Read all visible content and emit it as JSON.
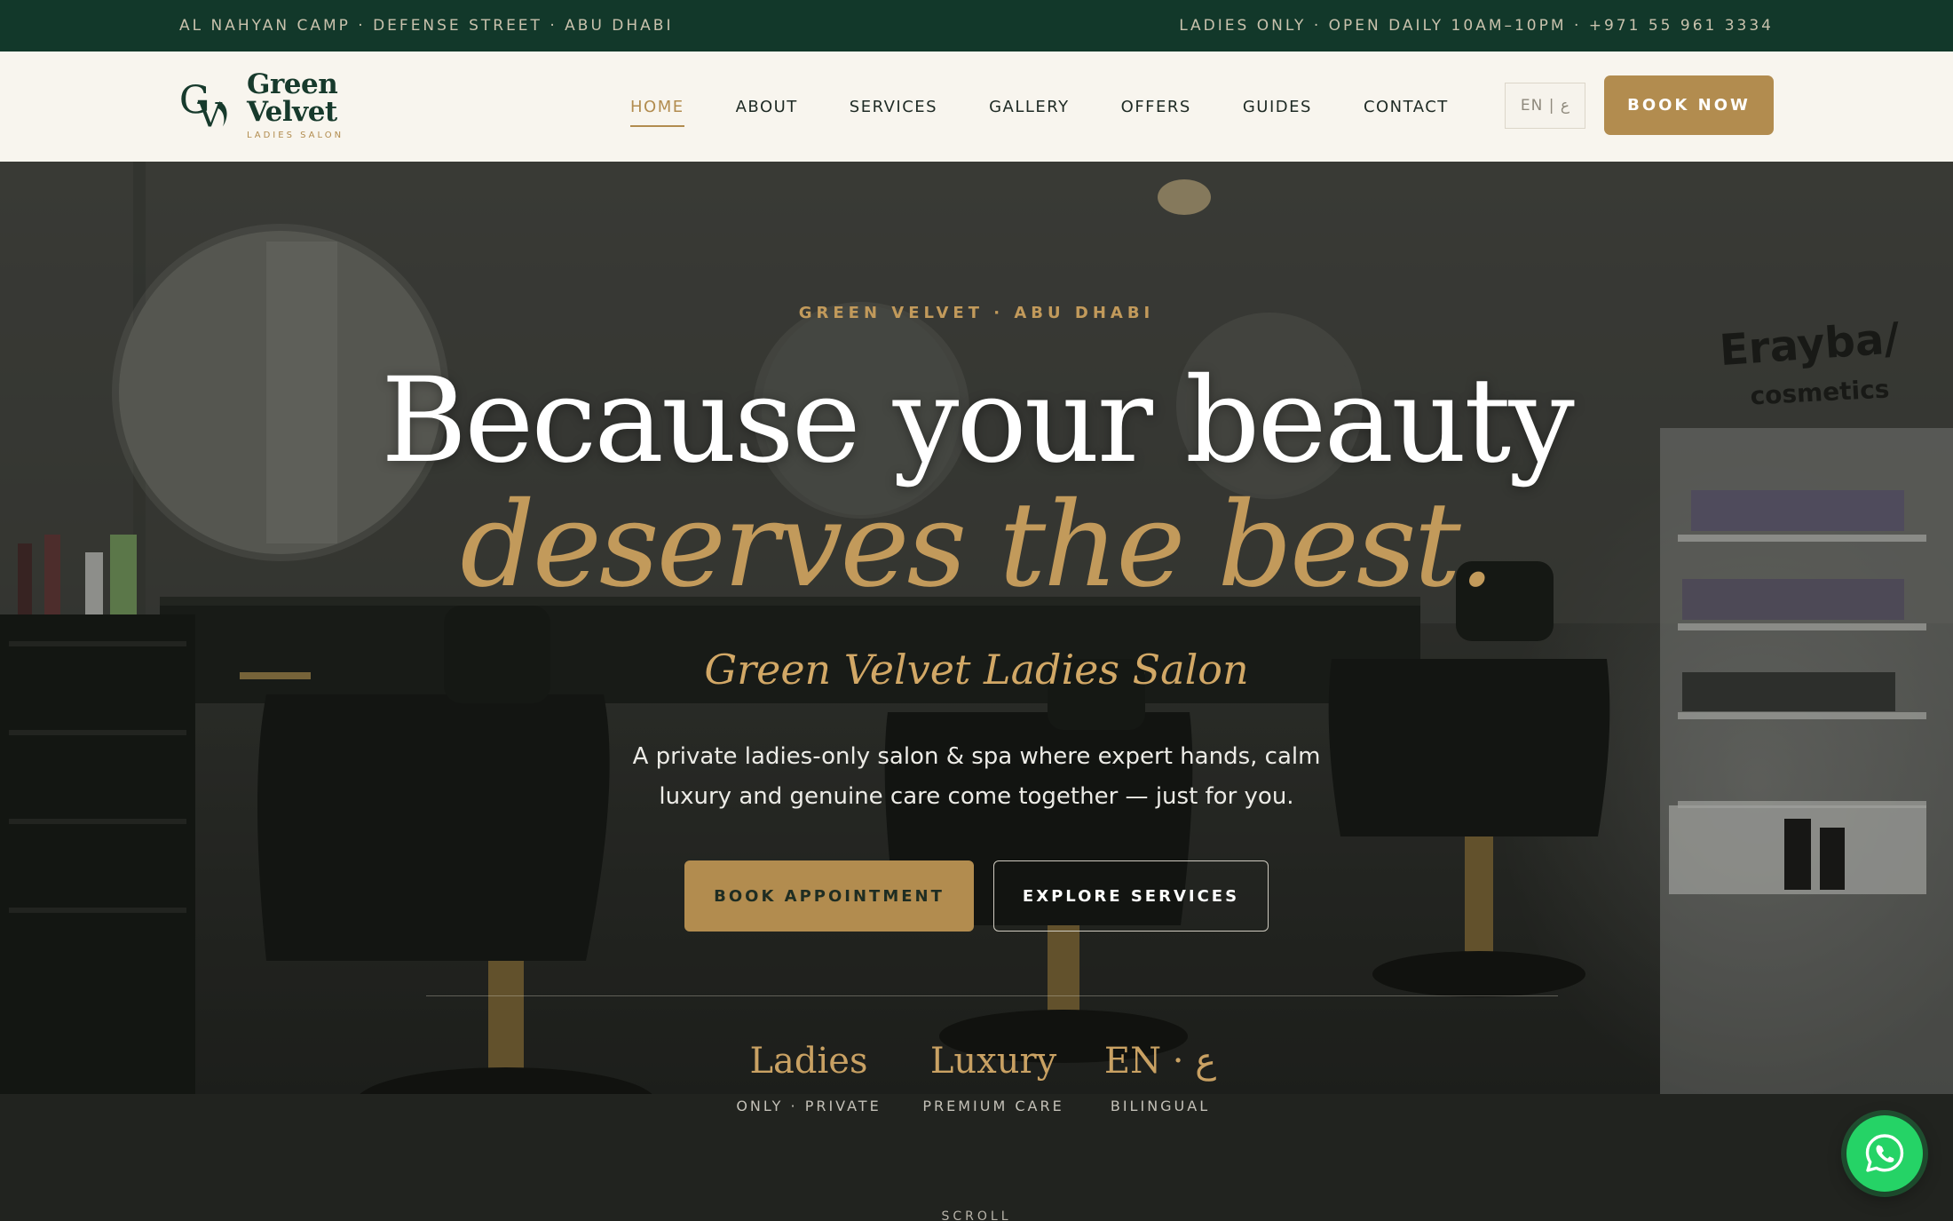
{
  "topbar": {
    "address": "AL NAHYAN CAMP · DEFENSE STREET · ABU DHABI",
    "info": "LADIES ONLY · OPEN DAILY 10AM–10PM · +971 55 961 3334"
  },
  "header": {
    "logo": {
      "name": "Green Velvet",
      "subtitle": "LADIES SALON",
      "icon": "gv-monogram-icon"
    },
    "nav": [
      {
        "label": "HOME",
        "active": true
      },
      {
        "label": "ABOUT",
        "active": false
      },
      {
        "label": "SERVICES",
        "active": false
      },
      {
        "label": "GALLERY",
        "active": false
      },
      {
        "label": "OFFERS",
        "active": false
      },
      {
        "label": "GUIDES",
        "active": false
      },
      {
        "label": "CONTACT",
        "active": false
      }
    ],
    "language_toggle": "EN | ع",
    "book_button": "BOOK NOW"
  },
  "hero": {
    "eyebrow": "GREEN VELVET · ABU DHABI",
    "headline_line1": "Because your beauty",
    "headline_line2": "deserves the best.",
    "subtitle": "Green Velvet Ladies Salon",
    "description_line1": "A private ladies-only salon & spa where expert hands, calm",
    "description_line2": "luxury and genuine care come together — just for you.",
    "primary_button": "BOOK APPOINTMENT",
    "secondary_button": "EXPLORE SERVICES",
    "background_sign": {
      "line1": "Erayba/",
      "line2": "cosmetics"
    },
    "stats": [
      {
        "value": "Ladies",
        "label": "ONLY · PRIVATE"
      },
      {
        "value": "Luxury",
        "label": "PREMIUM CARE"
      },
      {
        "value": "EN · ع",
        "label": "BILINGUAL"
      }
    ],
    "scroll_hint": "SCROLL"
  },
  "floating": {
    "whatsapp_icon": "whatsapp-icon"
  },
  "colors": {
    "topbar_bg": "#12382a",
    "header_bg": "#f8f5ee",
    "brand_green": "#173a2c",
    "accent_gold": "#b28c4f",
    "whatsapp_green": "#25d366"
  }
}
